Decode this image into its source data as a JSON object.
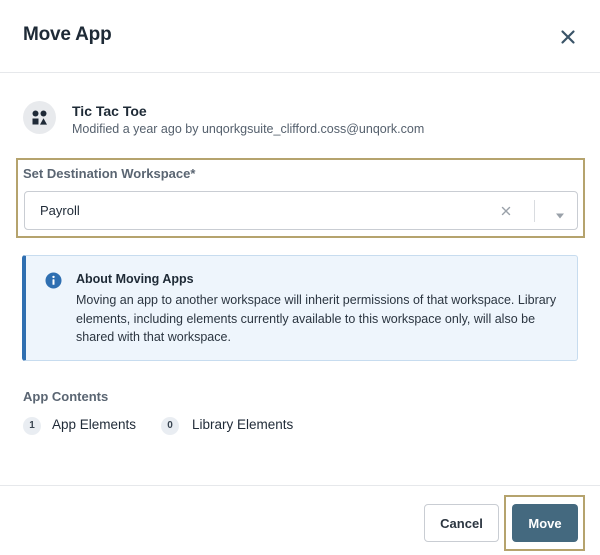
{
  "dialog": {
    "title": "Move App",
    "close_icon": "close-icon"
  },
  "app": {
    "icon": "tic-tac-toe-icon",
    "name": "Tic Tac Toe",
    "meta": "Modified a year ago by unqorkgsuite_clifford.coss@unqork.com"
  },
  "destination": {
    "label": "Set Destination Workspace*",
    "selected": "Payroll",
    "clear_icon": "clear-icon",
    "caret_icon": "chevron-down-icon"
  },
  "info": {
    "icon": "info-icon",
    "title": "About Moving Apps",
    "text": "Moving an app to another workspace will inherit permissions of that workspace. Library elements, including elements currently available to this workspace only, will also be shared with that workspace.",
    "accent_color": "#2f6fb1"
  },
  "contents": {
    "label": "App Contents",
    "app_elements": {
      "count": "1",
      "label": "App Elements"
    },
    "library_elements": {
      "count": "0",
      "label": "Library Elements"
    }
  },
  "footer": {
    "cancel_label": "Cancel",
    "move_label": "Move",
    "move_color": "#44697f"
  }
}
